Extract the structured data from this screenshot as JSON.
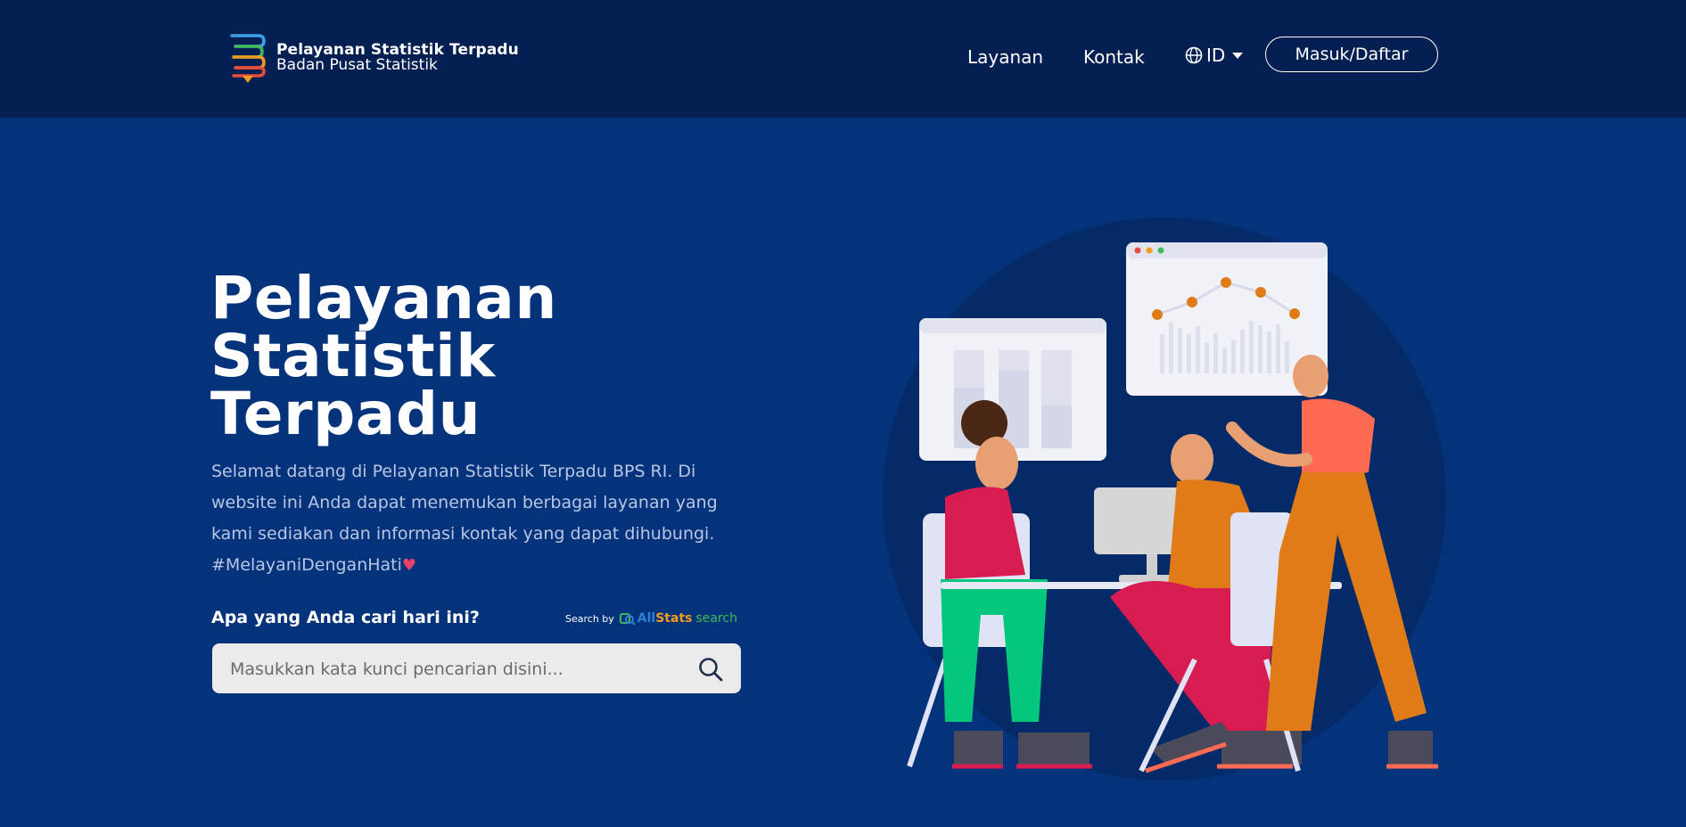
{
  "navbar": {
    "brand_title": "Pelayanan Statistik Terpadu",
    "brand_subtitle": "Badan Pusat Statistik",
    "links": [
      "Layanan",
      "Kontak"
    ],
    "language": "ID",
    "login_label": "Masuk/Daftar"
  },
  "hero": {
    "title_line1": "Pelayanan",
    "title_line2": "Statistik",
    "title_line3": "Terpadu",
    "description": "Selamat datang di Pelayanan Statistik Terpadu BPS RI. Di website ini Anda dapat menemukan berbagai layanan yang kami sediakan dan informasi kontak yang dapat dihubungi.",
    "hashtag": "#MelayaniDenganHati",
    "heart": "♥"
  },
  "search": {
    "label": "Apa yang Anda cari hari ini?",
    "search_by": "Search by",
    "brand_all": "All",
    "brand_stats": "Stats",
    "brand_search": "search",
    "placeholder": "Masukkan kata kunci pencarian disini..."
  },
  "colors": {
    "navbar_bg": "#041f51",
    "page_bg": "#05337b",
    "search_bg": "#ebebeb"
  }
}
